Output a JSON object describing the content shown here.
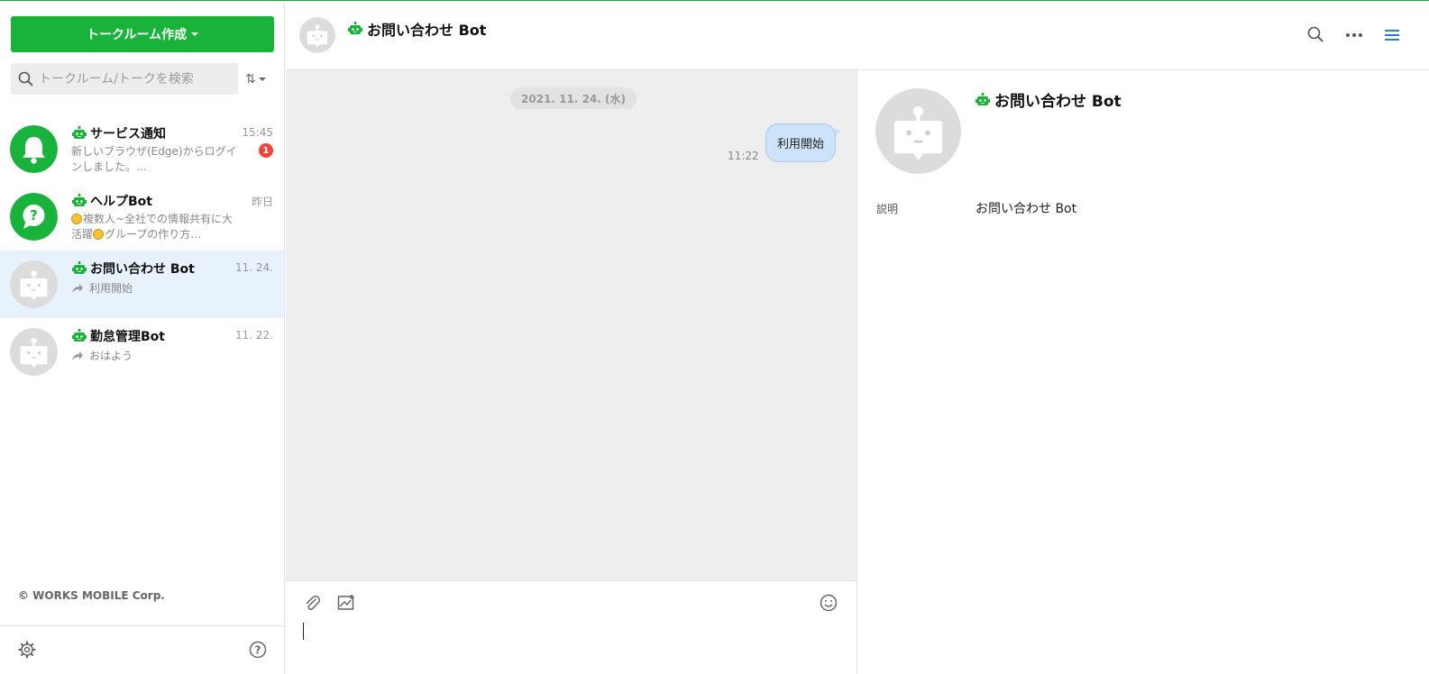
{
  "sidebar": {
    "create_button": "トークルーム作成",
    "search": {
      "placeholder": "トークルーム/トークを検索"
    },
    "sort_label": "⇅",
    "rooms": [
      {
        "name": "サービス通知",
        "time": "15:45",
        "preview": "新しいブラウザ(Edge)からログインしました。…",
        "badge": "1",
        "avatar_color": "#19b33c",
        "avatar_icon": "bell-icon"
      },
      {
        "name": "ヘルプBot",
        "time": "昨日",
        "preview_a": "複数人~全社での情報共有に大",
        "preview_b": "活躍",
        "preview_c": "グループの作り方…",
        "avatar_color": "#19b33c",
        "avatar_icon": "question-icon"
      },
      {
        "name": "お問い合わせ Bot",
        "time": "11. 24.",
        "preview": "利用開始",
        "avatar_icon": "bot-icon",
        "active": true
      },
      {
        "name": "勤怠管理Bot",
        "time": "11. 22.",
        "preview": "おはよう",
        "avatar_icon": "bot-icon"
      }
    ],
    "copyright": "© WORKS MOBILE Corp."
  },
  "chat": {
    "title": "お問い合わせ Bot",
    "date_chip": "2021. 11. 24. (水)",
    "message": {
      "text": "利用開始",
      "time": "11:22"
    }
  },
  "info": {
    "title": "お問い合わせ Bot",
    "desc_label": "説明",
    "desc_value": "お問い合わせ Bot"
  },
  "colors": {
    "accent": "#19b33c",
    "bubble": "#cde3fb",
    "active_row": "#e8f2fc",
    "badge": "#f04438"
  }
}
